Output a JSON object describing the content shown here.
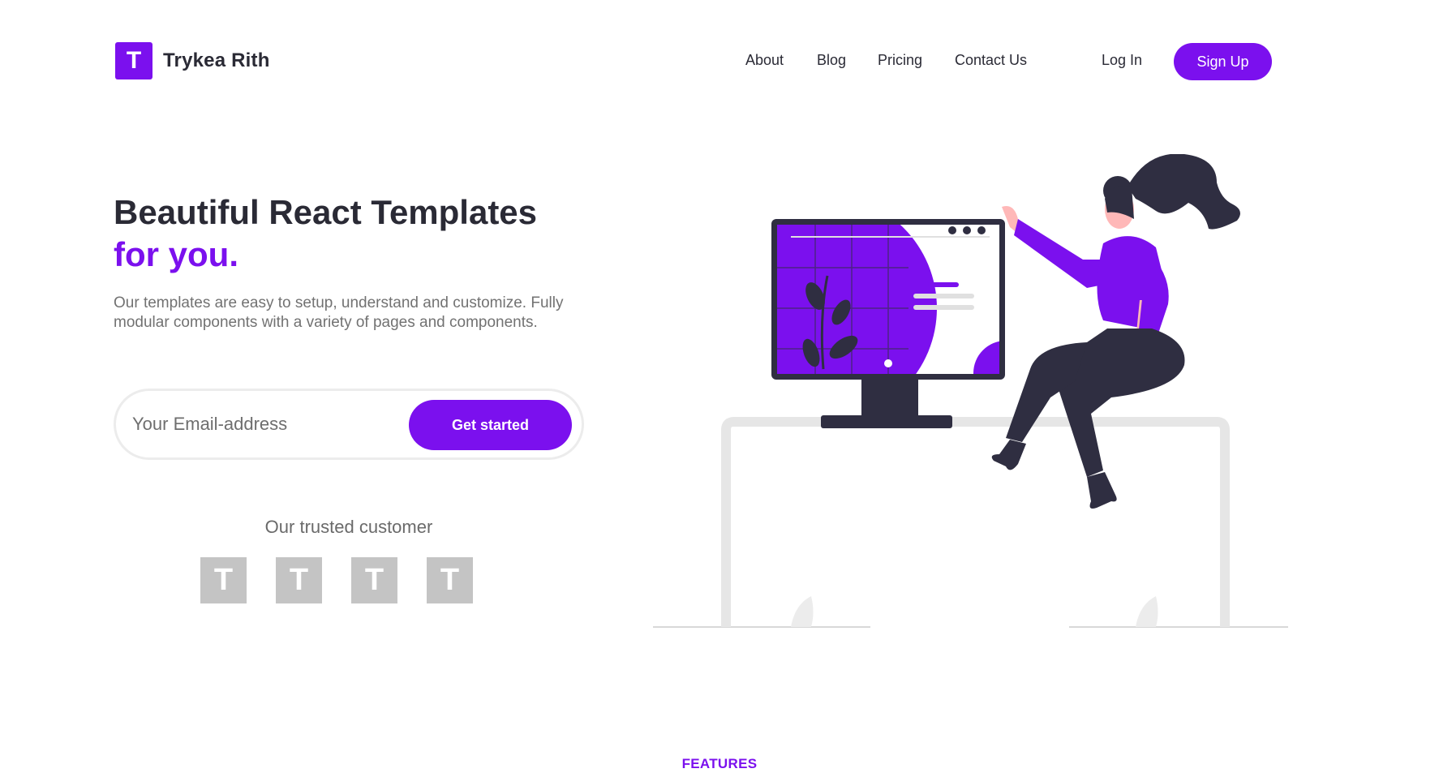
{
  "header": {
    "logo_letter": "T",
    "brand": "Trykea Rith",
    "nav": {
      "about": "About",
      "blog": "Blog",
      "pricing": "Pricing",
      "contact": "Contact Us",
      "login": "Log In"
    },
    "signup_label": "Sign Up"
  },
  "hero": {
    "title_line1": "Beautiful React Templates",
    "title_line2": "for you.",
    "description": "Our templates are easy to setup, understand and customize. Fully modular components with a variety of pages and components.",
    "email_placeholder": "Your Email-address",
    "cta_label": "Get started"
  },
  "trusted": {
    "label": "Our trusted customer",
    "logos": [
      "T",
      "T",
      "T",
      "T"
    ]
  },
  "section_label": "FEATURES",
  "colors": {
    "accent": "#7b10ee",
    "text": "#2a2a35",
    "muted": "#727272",
    "client_logo": "#c4c4c4"
  },
  "icons": {
    "logo": "brand-logo-icon",
    "illustration": "woman-at-computer-illustration"
  }
}
